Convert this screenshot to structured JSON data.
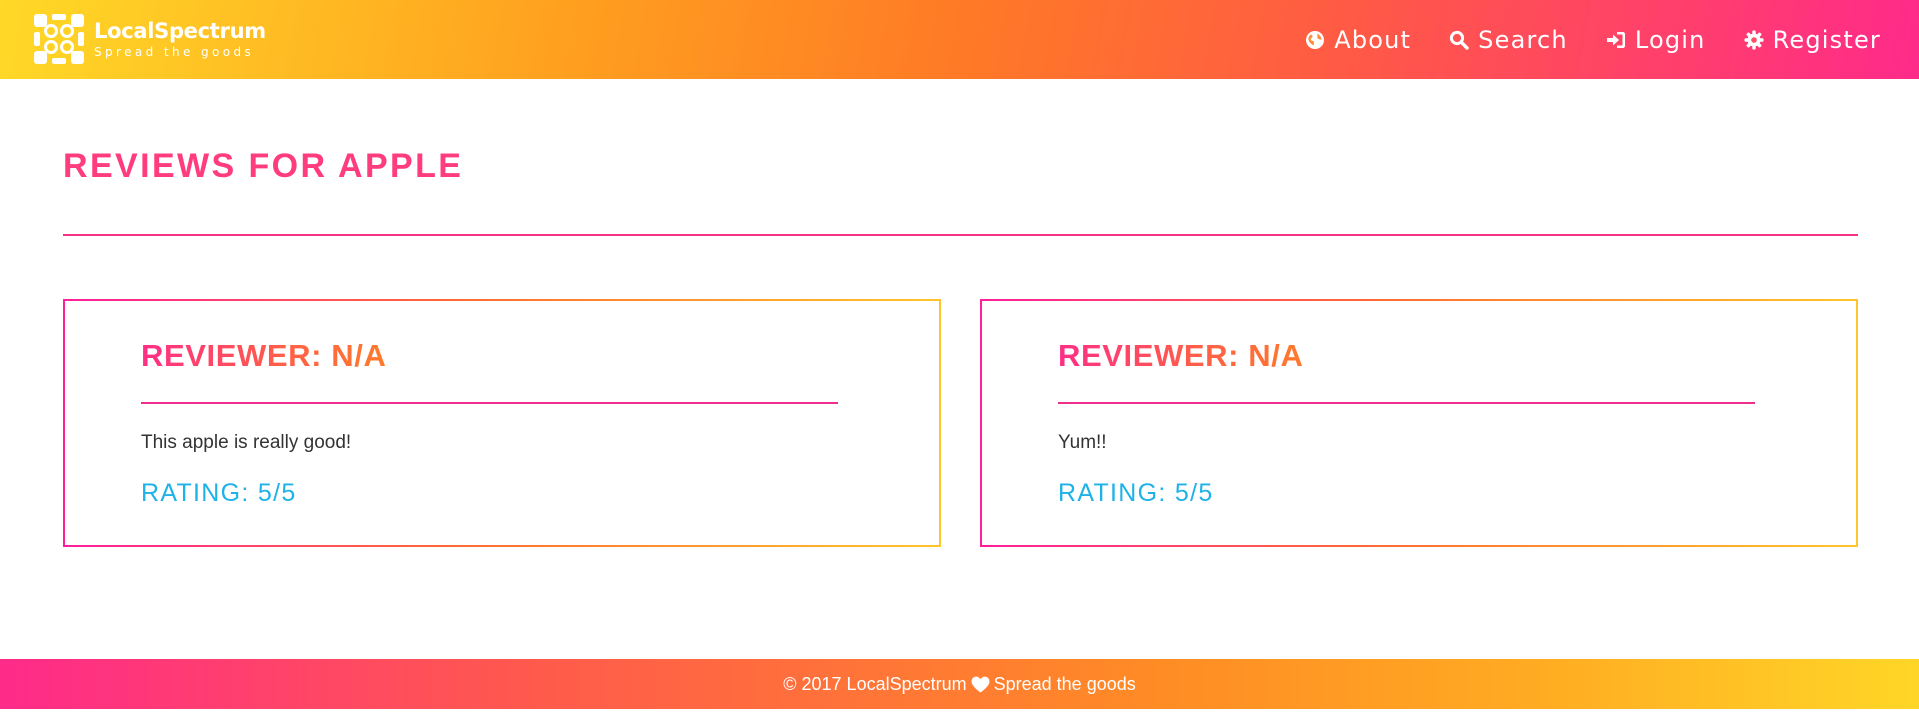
{
  "brand": {
    "name": "LocalSpectrum",
    "tagline": "Spread the goods",
    "logo_icon": "grid-logo-icon"
  },
  "nav": {
    "items": [
      {
        "label": "About",
        "icon": "globe-icon"
      },
      {
        "label": "Search",
        "icon": "search-icon"
      },
      {
        "label": "Login",
        "icon": "login-icon"
      },
      {
        "label": "Register",
        "icon": "gear-icon"
      }
    ]
  },
  "page": {
    "title": "Reviews for Apple"
  },
  "reviews": [
    {
      "reviewer": "Reviewer: N/A",
      "text": "This apple is really good!",
      "rating": "Rating: 5/5"
    },
    {
      "reviewer": "Reviewer: N/A",
      "text": "Yum!!",
      "rating": "Rating: 5/5"
    }
  ],
  "footer": {
    "copyright": "© 2017 LocalSpectrum",
    "tagline": "Spread the goods",
    "icon": "heart-icon"
  },
  "colors": {
    "title": "#ff3c7e",
    "rating": "#1eb2e8",
    "rule": "#f5318a",
    "header_gradient_start": "#ffd927",
    "header_gradient_end": "#ff2a8a"
  }
}
